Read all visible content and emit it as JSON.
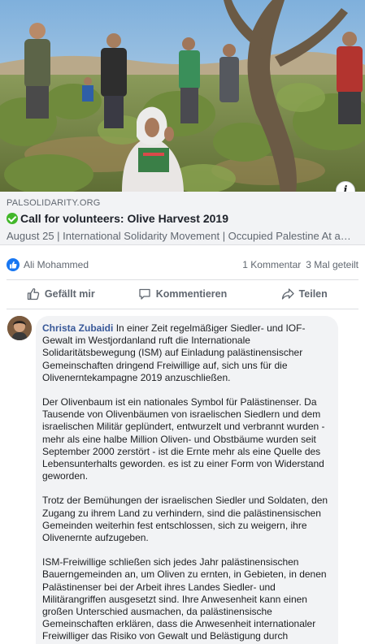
{
  "link_preview": {
    "domain": "PALSOLIDARITY.ORG",
    "title": "Call for volunteers: Olive Harvest 2019",
    "meta": "August 25 | International Solidarity Movement | Occupied Palestine At a…",
    "info_label": "i"
  },
  "reactions": {
    "reactor": "Ali Mohammed",
    "comments": "1 Kommentar",
    "shares": "3 Mal geteilt"
  },
  "actions": {
    "like": "Gefällt mir",
    "comment": "Kommentieren",
    "share": "Teilen"
  },
  "comment": {
    "author": "Christa Zubaidi",
    "paragraph_1": "In einer Zeit regelmäßiger Siedler- und IOF-Gewalt im Westjordanland ruft die Internationale Solidaritätsbewegung (ISM) auf Einladung palästinensischer Gemeinschaften dringend Freiwillige auf, sich uns für die Olivenerntekampagne 2019 anzuschließen.",
    "paragraph_2": "Der Olivenbaum ist ein nationales Symbol für Palästinenser. Da Tausende von Olivenbäumen von israelischen Siedlern und dem israelischen Militär geplündert, entwurzelt und verbrannt wurden - mehr als eine halbe Million Oliven- und Obstbäume wurden seit September 2000 zerstört - ist die Ernte mehr als eine Quelle des Lebensunterhalts geworden. es ist zu einer Form von Widerstand geworden.",
    "paragraph_3": "Trotz der Bemühungen der israelischen Siedler und Soldaten, den Zugang zu ihrem Land zu verhindern, sind die palästinensischen Gemeinden weiterhin fest entschlossen, sich zu weigern, ihre Olivenernte aufzugeben.",
    "paragraph_4": "ISM-Freiwillige schließen sich jedes Jahr palästinensischen Bauerngemeinden an, um Oliven zu ernten, in Gebieten, in denen Palästinenser bei der Arbeit ihres Landes Siedler- und Militärangriffen ausgesetzt sind. Ihre Anwesenheit kann einen großen Unterschied ausmachen, da palästinensische Gemeinschaften erklären, dass die Anwesenheit internationaler Freiwilliger das Risiko von Gewalt und Belästigung durch israelische Siedler und die israelische Armee verringert."
  },
  "colors": {
    "link": "#385898",
    "like_blue": "#1877f2",
    "verified_green": "#42b72a",
    "muted_text": "#606770",
    "bubble_bg": "#f2f3f5"
  },
  "icons": [
    "info-icon",
    "verified-check-icon",
    "like-reaction-icon",
    "thumbs-up-icon",
    "comment-icon",
    "share-icon"
  ]
}
